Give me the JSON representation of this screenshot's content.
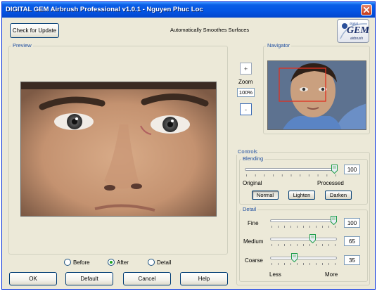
{
  "window": {
    "title": "DIGITAL GEM Airbrush Professional v1.0.1 - Nguyen Phuc Loc"
  },
  "header": {
    "check_update_label": "Check for Update",
    "subtitle": "Automatically Smoothes Surfaces"
  },
  "logo": {
    "text": "GEM",
    "small_top": "digital",
    "small_bottom": "airbrush"
  },
  "preview": {
    "label": "Preview"
  },
  "navigator": {
    "label": "Navigator"
  },
  "zoom": {
    "plus": "+",
    "label": "Zoom",
    "value": "100%",
    "minus": "-"
  },
  "view_mode": {
    "options": [
      {
        "label": "Before",
        "selected": false
      },
      {
        "label": "After",
        "selected": true
      },
      {
        "label": "Detail",
        "selected": false
      }
    ]
  },
  "controls": {
    "label": "Controls",
    "blending": {
      "label": "Blending",
      "value": "100",
      "level": 1.0,
      "left_label": "Original",
      "right_label": "Processed",
      "modes": [
        {
          "label": "Normal",
          "active": true
        },
        {
          "label": "Lighten",
          "active": false
        },
        {
          "label": "Darken",
          "active": false
        }
      ]
    },
    "detail": {
      "label": "Detail",
      "fine": {
        "label": "Fine",
        "value": "100",
        "level": 1.0
      },
      "medium": {
        "label": "Medium",
        "value": "65",
        "level": 0.65
      },
      "coarse": {
        "label": "Coarse",
        "value": "35",
        "level": 0.35
      },
      "less_label": "Less",
      "more_label": "More"
    }
  },
  "buttons": {
    "ok": "OK",
    "default": "Default",
    "cancel": "Cancel",
    "help": "Help"
  },
  "colors": {
    "title_bar": "#0454e3",
    "group_label": "#1e4ea0",
    "nav_rect": "#e03020"
  }
}
